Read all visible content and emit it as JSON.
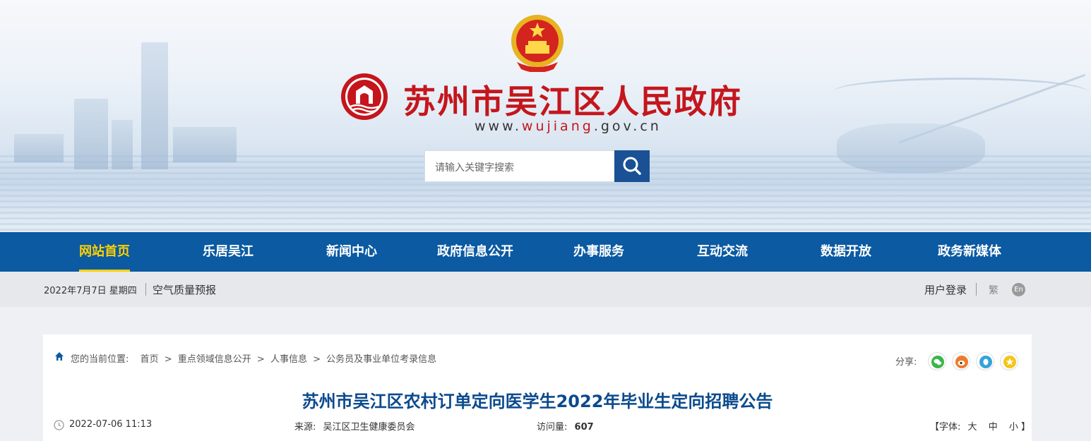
{
  "header": {
    "site_title": "苏州市吴江区人民政府",
    "url_prefix": "www.",
    "url_highlight": "wujiang",
    "url_suffix": ".gov.cn",
    "search_placeholder": "请输入关键字搜索"
  },
  "nav": {
    "items": [
      {
        "label": "网站首页",
        "active": true
      },
      {
        "label": "乐居吴江",
        "active": false
      },
      {
        "label": "新闻中心",
        "active": false
      },
      {
        "label": "政府信息公开",
        "active": false
      },
      {
        "label": "办事服务",
        "active": false
      },
      {
        "label": "互动交流",
        "active": false
      },
      {
        "label": "数据开放",
        "active": false
      },
      {
        "label": "政务新媒体",
        "active": false
      }
    ]
  },
  "infobar": {
    "date": "2022年7月7日 星期四",
    "air_quality": "空气质量预报",
    "login": "用户登录",
    "traditional": "繁",
    "english": "En"
  },
  "breadcrumb": {
    "label": "您的当前位置:",
    "items": [
      "首页",
      ">",
      "重点领域信息公开",
      ">",
      "人事信息",
      ">",
      "公务员及事业单位考录信息"
    ]
  },
  "share": {
    "label": "分享:",
    "icons": [
      "wechat-icon",
      "weibo-icon",
      "qq-icon",
      "favorite-icon"
    ]
  },
  "article": {
    "title": "苏州市吴江区农村订单定向医学生2022年毕业生定向招聘公告",
    "datetime": "2022-07-06 11:13",
    "source_label": "来源:",
    "source": "吴江区卫生健康委员会",
    "views_label": "访问量:",
    "views": "607",
    "font_label": "【字体:",
    "font_large": "大",
    "font_medium": "中",
    "font_small": "小",
    "font_close": "】"
  },
  "colors": {
    "brand_red": "#c4161c",
    "nav_blue": "#0b5aa2",
    "nav_active": "#ffd100",
    "title_blue": "#0b4a8d",
    "search_button": "#1a5195"
  }
}
